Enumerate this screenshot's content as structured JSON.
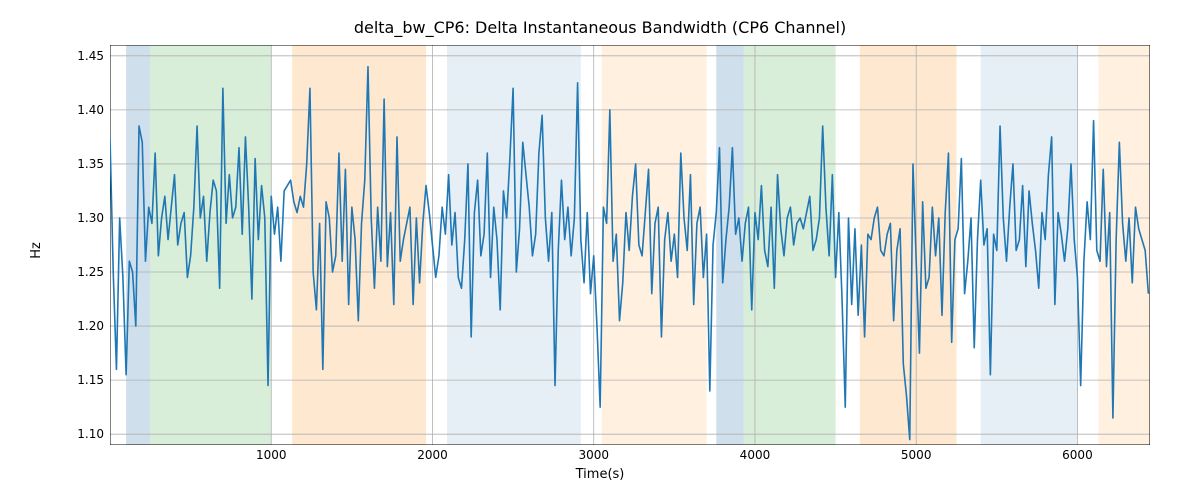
{
  "chart_data": {
    "type": "line",
    "title": "delta_bw_CP6: Delta Instantaneous Bandwidth (CP6 Channel)",
    "xlabel": "Time(s)",
    "ylabel": "Hz",
    "xlim": [
      0,
      6450
    ],
    "ylim": [
      1.09,
      1.46
    ],
    "xticks": [
      1000,
      2000,
      3000,
      4000,
      5000,
      6000
    ],
    "yticks": [
      1.1,
      1.15,
      1.2,
      1.25,
      1.3,
      1.35,
      1.4,
      1.45
    ],
    "line_color": "#1f77b4",
    "background_bands": [
      {
        "x0": 100,
        "x1": 250,
        "color": "#a7c4dd",
        "alpha": 0.55
      },
      {
        "x0": 250,
        "x1": 1000,
        "color": "#b8e0b8",
        "alpha": 0.55
      },
      {
        "x0": 1130,
        "x1": 1960,
        "color": "#ffd8b1",
        "alpha": 0.6
      },
      {
        "x0": 2090,
        "x1": 2920,
        "color": "#d6e4f0",
        "alpha": 0.6
      },
      {
        "x0": 3050,
        "x1": 3700,
        "color": "#ffe6cc",
        "alpha": 0.6
      },
      {
        "x0": 3760,
        "x1": 3930,
        "color": "#a7c4dd",
        "alpha": 0.55
      },
      {
        "x0": 3930,
        "x1": 4500,
        "color": "#b8e0b8",
        "alpha": 0.55
      },
      {
        "x0": 4650,
        "x1": 5250,
        "color": "#ffd8b1",
        "alpha": 0.6
      },
      {
        "x0": 5400,
        "x1": 6000,
        "color": "#d6e4f0",
        "alpha": 0.6
      },
      {
        "x0": 6130,
        "x1": 6450,
        "color": "#ffe6cc",
        "alpha": 0.6
      }
    ],
    "series": [
      {
        "name": "delta_bw_CP6",
        "x_step": 20,
        "x_start": 0,
        "values": [
          1.375,
          1.25,
          1.16,
          1.3,
          1.245,
          1.155,
          1.26,
          1.25,
          1.2,
          1.385,
          1.37,
          1.26,
          1.31,
          1.295,
          1.36,
          1.265,
          1.3,
          1.32,
          1.28,
          1.31,
          1.34,
          1.275,
          1.295,
          1.305,
          1.245,
          1.265,
          1.31,
          1.385,
          1.3,
          1.32,
          1.26,
          1.305,
          1.335,
          1.325,
          1.235,
          1.42,
          1.295,
          1.34,
          1.3,
          1.31,
          1.365,
          1.285,
          1.375,
          1.31,
          1.225,
          1.355,
          1.28,
          1.33,
          1.3,
          1.145,
          1.32,
          1.285,
          1.31,
          1.26,
          1.325,
          1.33,
          1.335,
          1.315,
          1.305,
          1.32,
          1.31,
          1.35,
          1.42,
          1.25,
          1.215,
          1.295,
          1.16,
          1.315,
          1.3,
          1.25,
          1.265,
          1.36,
          1.26,
          1.345,
          1.22,
          1.31,
          1.28,
          1.205,
          1.295,
          1.335,
          1.44,
          1.3,
          1.235,
          1.31,
          1.26,
          1.41,
          1.255,
          1.305,
          1.22,
          1.375,
          1.26,
          1.28,
          1.295,
          1.31,
          1.22,
          1.3,
          1.24,
          1.295,
          1.33,
          1.305,
          1.275,
          1.245,
          1.265,
          1.31,
          1.285,
          1.34,
          1.275,
          1.305,
          1.245,
          1.235,
          1.28,
          1.35,
          1.19,
          1.305,
          1.335,
          1.265,
          1.285,
          1.36,
          1.245,
          1.31,
          1.28,
          1.215,
          1.325,
          1.3,
          1.355,
          1.42,
          1.25,
          1.29,
          1.37,
          1.34,
          1.31,
          1.265,
          1.285,
          1.36,
          1.395,
          1.3,
          1.26,
          1.305,
          1.145,
          1.27,
          1.335,
          1.28,
          1.31,
          1.265,
          1.3,
          1.425,
          1.28,
          1.24,
          1.305,
          1.23,
          1.265,
          1.2,
          1.125,
          1.31,
          1.295,
          1.4,
          1.26,
          1.285,
          1.205,
          1.24,
          1.305,
          1.27,
          1.32,
          1.35,
          1.275,
          1.265,
          1.305,
          1.345,
          1.23,
          1.295,
          1.31,
          1.19,
          1.28,
          1.305,
          1.26,
          1.285,
          1.245,
          1.36,
          1.3,
          1.27,
          1.34,
          1.22,
          1.295,
          1.31,
          1.245,
          1.285,
          1.14,
          1.275,
          1.305,
          1.365,
          1.24,
          1.28,
          1.31,
          1.365,
          1.285,
          1.3,
          1.26,
          1.295,
          1.31,
          1.215,
          1.305,
          1.28,
          1.33,
          1.27,
          1.255,
          1.31,
          1.235,
          1.34,
          1.29,
          1.265,
          1.3,
          1.31,
          1.275,
          1.295,
          1.3,
          1.29,
          1.305,
          1.32,
          1.27,
          1.28,
          1.3,
          1.385,
          1.31,
          1.265,
          1.34,
          1.245,
          1.305,
          1.225,
          1.125,
          1.3,
          1.22,
          1.29,
          1.21,
          1.275,
          1.19,
          1.285,
          1.28,
          1.3,
          1.31,
          1.27,
          1.265,
          1.285,
          1.295,
          1.205,
          1.27,
          1.29,
          1.165,
          1.135,
          1.095,
          1.35,
          1.26,
          1.175,
          1.315,
          1.235,
          1.245,
          1.31,
          1.265,
          1.3,
          1.21,
          1.305,
          1.36,
          1.185,
          1.28,
          1.29,
          1.355,
          1.23,
          1.26,
          1.3,
          1.18,
          1.28,
          1.335,
          1.275,
          1.29,
          1.155,
          1.285,
          1.27,
          1.385,
          1.3,
          1.26,
          1.31,
          1.35,
          1.27,
          1.28,
          1.33,
          1.255,
          1.325,
          1.295,
          1.27,
          1.235,
          1.305,
          1.28,
          1.34,
          1.375,
          1.22,
          1.305,
          1.285,
          1.26,
          1.29,
          1.35,
          1.28,
          1.245,
          1.145,
          1.26,
          1.315,
          1.28,
          1.39,
          1.27,
          1.26,
          1.345,
          1.255,
          1.305,
          1.115,
          1.28,
          1.37,
          1.295,
          1.26,
          1.3,
          1.24,
          1.31,
          1.29,
          1.28,
          1.27,
          1.23
        ]
      }
    ]
  }
}
